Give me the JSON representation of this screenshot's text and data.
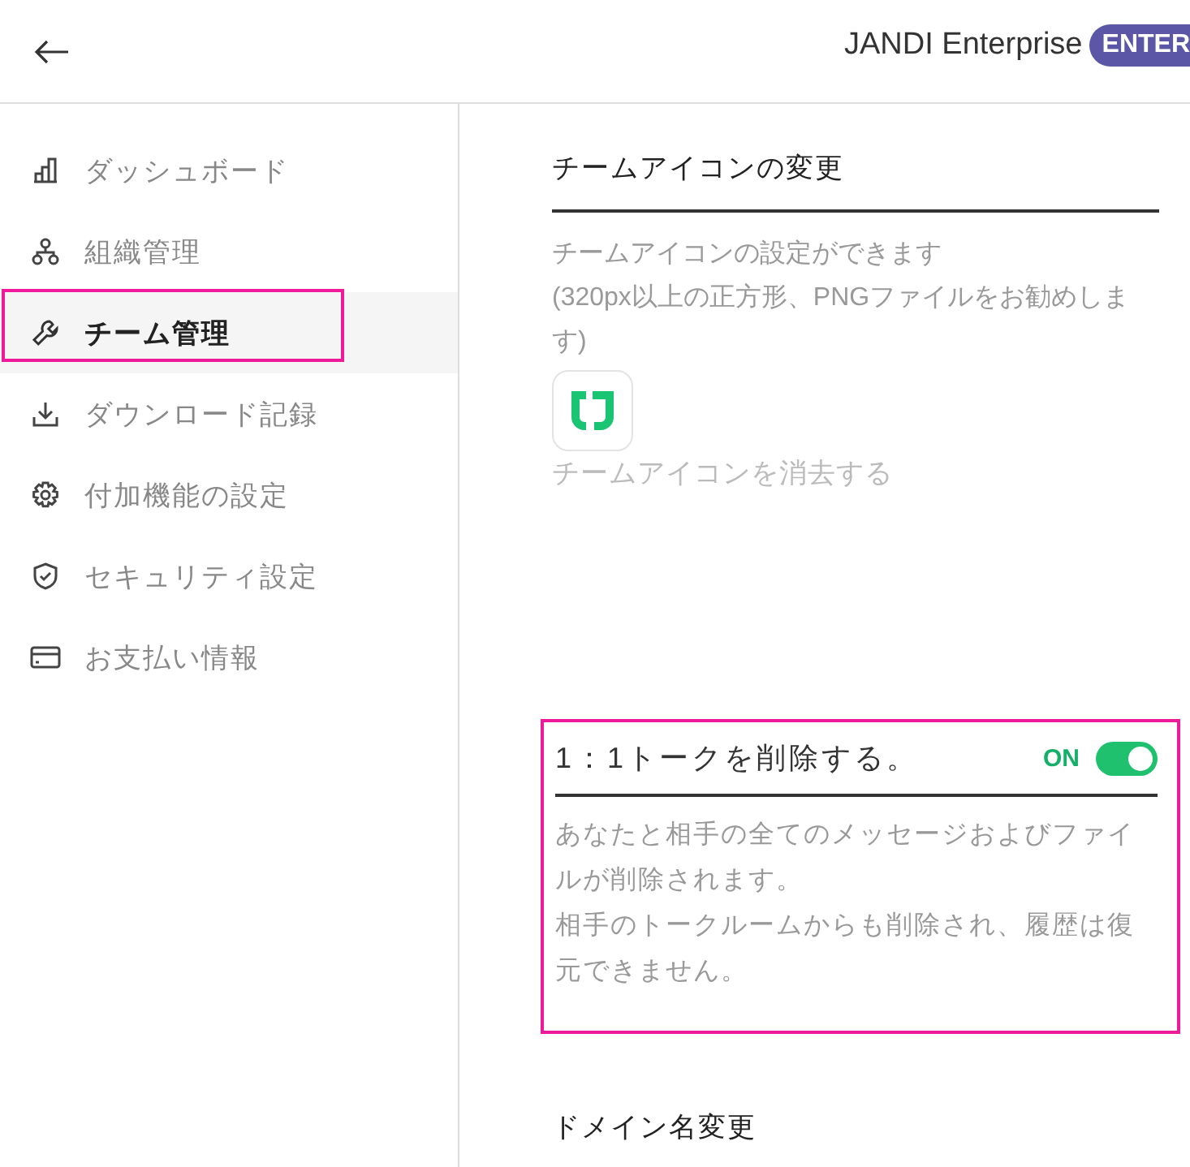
{
  "header": {
    "title": "JANDI Enterprise",
    "badge": "ENTER"
  },
  "sidebar": {
    "items": [
      {
        "label": "ダッシュボード",
        "selected": false,
        "highlighted": false
      },
      {
        "label": "組織管理",
        "selected": false,
        "highlighted": false
      },
      {
        "label": "チーム管理",
        "selected": true,
        "highlighted": true
      },
      {
        "label": "ダウンロード記録",
        "selected": false,
        "highlighted": false
      },
      {
        "label": "付加機能の設定",
        "selected": false,
        "highlighted": false
      },
      {
        "label": "セキュリティ設定",
        "selected": false,
        "highlighted": false
      },
      {
        "label": "お支払い情報",
        "selected": false,
        "highlighted": false
      }
    ]
  },
  "team_icon": {
    "title": "チームアイコンの変更",
    "description": [
      "チームアイコンの設定ができます",
      "(320px以上の正方形、PNGファイルをお勧めします)"
    ],
    "remove_link": "チームアイコンを消去する"
  },
  "delete_dm": {
    "title": "1：1トークを削除する。",
    "toggle_label": "ON",
    "on": true,
    "highlighted": true,
    "description": [
      "あなたと相手の全てのメッセージおよびファイルが削除されます。",
      "相手のトークルームからも削除され、履歴は復元できません。"
    ]
  },
  "domain": {
    "title": "ドメイン名変更"
  }
}
